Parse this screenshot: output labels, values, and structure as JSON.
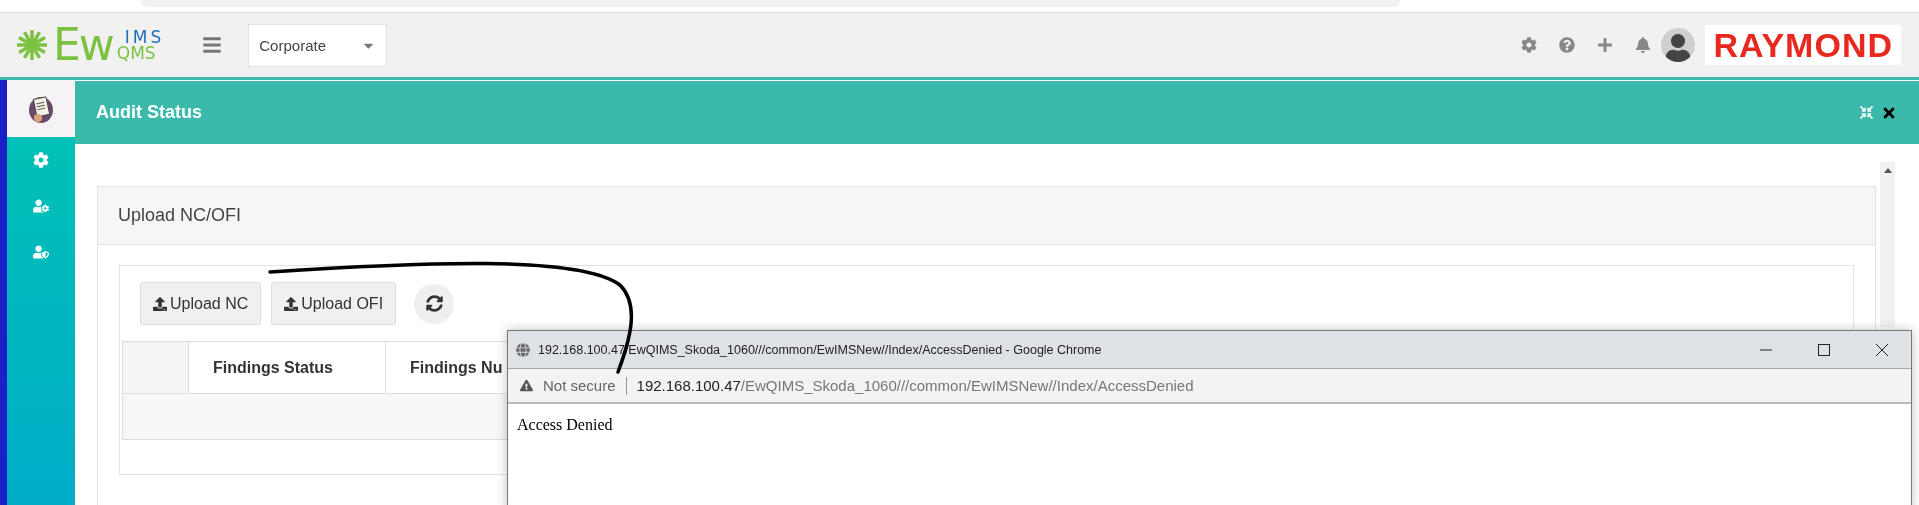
{
  "header": {
    "logo": {
      "main": "Ew",
      "top": "IMS",
      "bottom": "QMS"
    },
    "site_select": {
      "value": "Corporate"
    },
    "brand": "RAYMOND"
  },
  "sidebar": {
    "items": [
      {
        "kind": "document",
        "selected": true
      },
      {
        "kind": "settings",
        "selected": false
      },
      {
        "kind": "users",
        "selected": false
      },
      {
        "kind": "user-shield",
        "selected": false
      }
    ]
  },
  "panel": {
    "title": "Audit Status"
  },
  "card": {
    "title": "Upload NC/OFI",
    "buttons": [
      "Upload NC",
      "Upload OFI"
    ],
    "table": {
      "columns": [
        "Findings Status",
        "Findings Nu"
      ]
    }
  },
  "popup": {
    "title": "192.168.100.47/EwQIMS_Skoda_1060///common/EwIMSNew//Index/AccessDenied - Google Chrome",
    "security": "Not secure",
    "url_host": "192.168.100.47",
    "url_path": "/EwQIMS_Skoda_1060///common/EwIMSNew//Index/AccessDenied",
    "body": "Access Denied"
  }
}
